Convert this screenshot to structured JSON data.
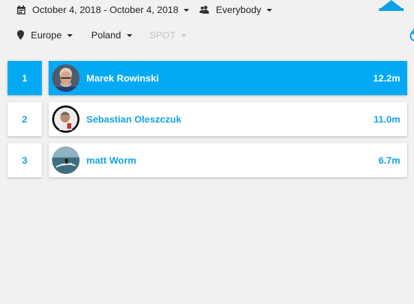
{
  "filters": {
    "date_range": "October 4, 2018 - October 4, 2018",
    "audience": "Everybody",
    "region": "Europe",
    "country": "Poland",
    "spot": "SPOT"
  },
  "leaderboard": [
    {
      "rank": "1",
      "name": "Marek Rowinski",
      "distance": "12.2m"
    },
    {
      "rank": "2",
      "name": "Sebastian Oleszczuk",
      "distance": "11.0m"
    },
    {
      "rank": "3",
      "name": "matt Worm",
      "distance": "6.7m"
    }
  ],
  "colors": {
    "accent": "#03a9f4",
    "text_accent": "#11a3e8",
    "background": "#f1f1f1",
    "disabled": "#c4c4c4"
  }
}
